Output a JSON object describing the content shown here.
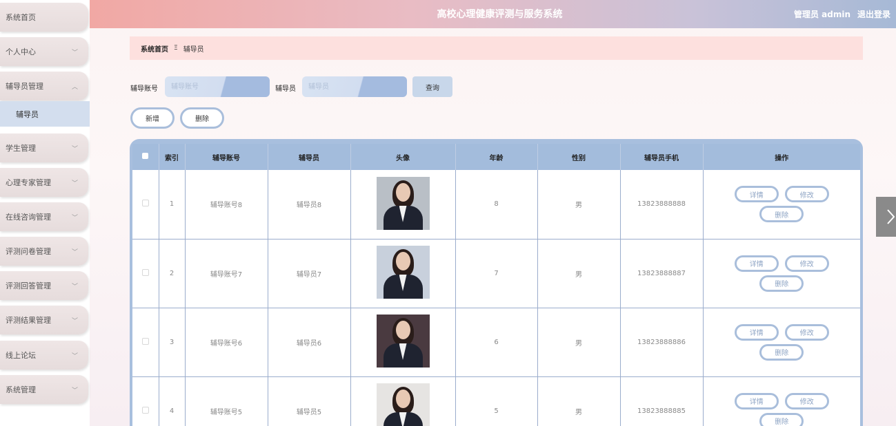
{
  "header": {
    "title": "高校心理健康评测与服务系统",
    "user": "管理员 admin",
    "logout": "退出登录"
  },
  "sidebar": {
    "items": [
      {
        "label": "系统首页",
        "chevron": ""
      },
      {
        "label": "个人中心",
        "chevron": "﹀"
      },
      {
        "label": "辅导员管理",
        "chevron": "︿"
      },
      {
        "label": "学生管理",
        "chevron": "﹀"
      },
      {
        "label": "心理专家管理",
        "chevron": "﹀"
      },
      {
        "label": "在线咨询管理",
        "chevron": "﹀"
      },
      {
        "label": "评测问卷管理",
        "chevron": "﹀"
      },
      {
        "label": "评测回答管理",
        "chevron": "﹀"
      },
      {
        "label": "评测结果管理",
        "chevron": "﹀"
      },
      {
        "label": "线上论坛",
        "chevron": "﹀"
      },
      {
        "label": "系统管理",
        "chevron": "﹀"
      }
    ],
    "sub_item": "辅导员"
  },
  "breadcrumb": {
    "home": "系统首页",
    "separator": "Ξ",
    "current": "辅导员"
  },
  "search": {
    "account_label": "辅导账号",
    "account_placeholder": "辅导账号",
    "name_label": "辅导员",
    "name_placeholder": "辅导员",
    "query_button": "查询"
  },
  "actions": {
    "add": "新增",
    "delete": "删除"
  },
  "table": {
    "columns": [
      "",
      "索引",
      "辅导账号",
      "辅导员",
      "头像",
      "年龄",
      "性别",
      "辅导员手机",
      "操作"
    ],
    "rows": [
      {
        "index": "1",
        "account": "辅导账号8",
        "name": "辅导员8",
        "age": "8",
        "gender": "男",
        "phone": "13823888888"
      },
      {
        "index": "2",
        "account": "辅导账号7",
        "name": "辅导员7",
        "age": "7",
        "gender": "男",
        "phone": "13823888887"
      },
      {
        "index": "3",
        "account": "辅导账号6",
        "name": "辅导员6",
        "age": "6",
        "gender": "男",
        "phone": "13823888886"
      },
      {
        "index": "4",
        "account": "辅导账号5",
        "name": "辅导员5",
        "age": "5",
        "gender": "男",
        "phone": "13823888885"
      }
    ],
    "row_actions": {
      "detail": "详情",
      "edit": "修改",
      "delete": "删除"
    }
  },
  "colors": {
    "accent": "#a9bedb",
    "breadcrumb_bg": "#fde0de",
    "table_header": "#a3bcdc"
  }
}
